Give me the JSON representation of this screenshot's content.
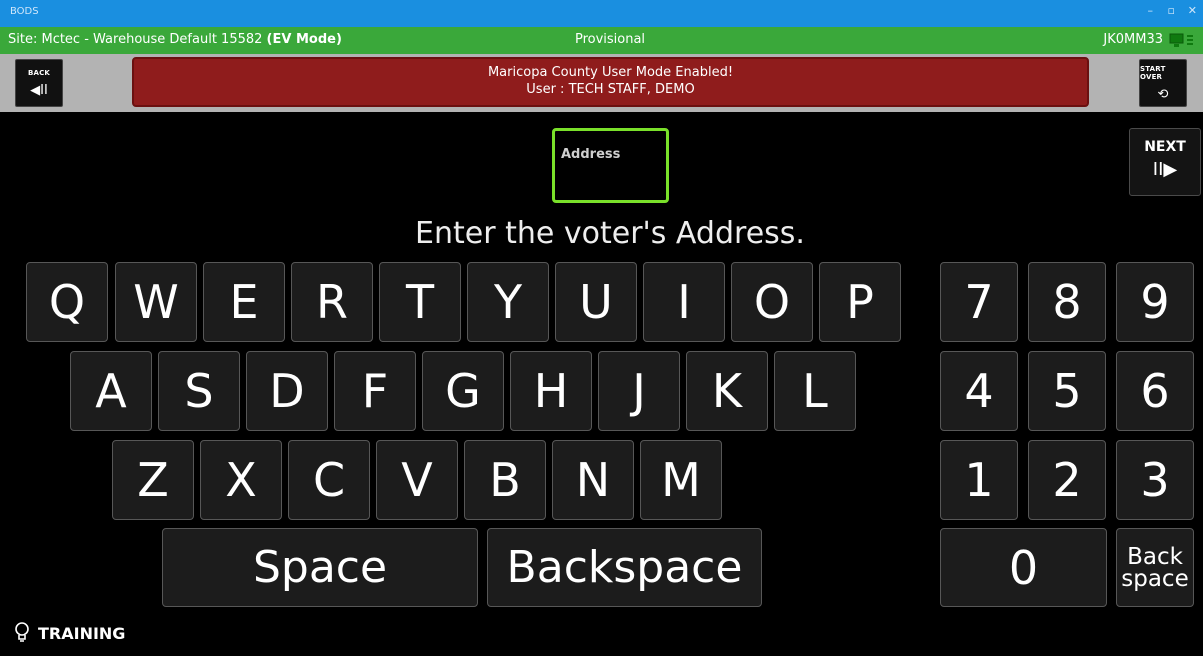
{
  "window": {
    "title": "BODS",
    "controls": [
      "–",
      "▫",
      "✕"
    ]
  },
  "status": {
    "site_prefix": "Site: Mctec - Warehouse Default 15582 ",
    "mode": "(EV Mode)",
    "state": "Provisional",
    "user_id": "JK0MM33"
  },
  "header": {
    "back_label": "BACK",
    "back_icon": "◀II",
    "banner_line1": "Maricopa County User Mode Enabled!",
    "banner_line2": "User : TECH STAFF, DEMO",
    "start_over_label": "START OVER",
    "start_over_icon": "⟲"
  },
  "field": {
    "label": "Address",
    "value": ""
  },
  "next": {
    "label": "NEXT",
    "icon": "II▶"
  },
  "prompt": "Enter the voter's Address.",
  "keyboard": {
    "row1": [
      "Q",
      "W",
      "E",
      "R",
      "T",
      "Y",
      "U",
      "I",
      "O",
      "P"
    ],
    "row2": [
      "A",
      "S",
      "D",
      "F",
      "G",
      "H",
      "J",
      "K",
      "L"
    ],
    "row3": [
      "Z",
      "X",
      "C",
      "V",
      "B",
      "N",
      "M"
    ],
    "space": "Space",
    "backspace": "Backspace"
  },
  "numpad": {
    "row1": [
      "7",
      "8",
      "9"
    ],
    "row2": [
      "4",
      "5",
      "6"
    ],
    "row3": [
      "1",
      "2",
      "3"
    ],
    "zero": "0",
    "back_line1": "Back",
    "back_line2": "space"
  },
  "footer": {
    "training_icon": "💡",
    "training_label": "TRAINING"
  },
  "colors": {
    "titlebar": "#1a8fe0",
    "statusbar": "#3aa83a",
    "banner": "#8f1c1c",
    "field_border": "#7ae02a"
  }
}
